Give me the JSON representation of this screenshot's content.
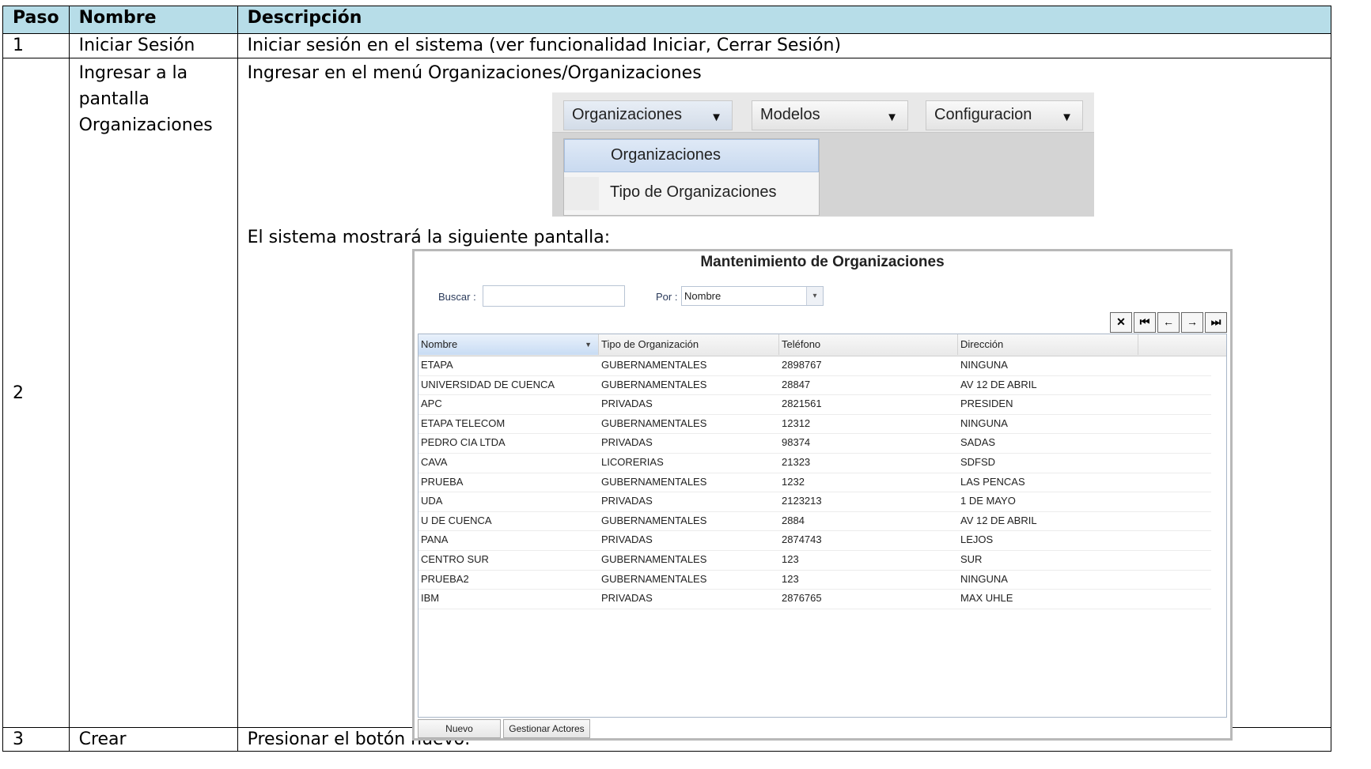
{
  "table": {
    "headers": {
      "paso": "Paso",
      "nombre": "Nombre",
      "descripcion": "Descripción"
    },
    "rows": [
      {
        "paso": "1",
        "nombre": "Iniciar Sesión",
        "descripcion": "Iniciar sesión en el sistema (ver funcionalidad Iniciar, Cerrar Sesión)"
      },
      {
        "paso": "2",
        "nombre_lines": [
          "Ingresar a la",
          "pantalla",
          "Organizaciones"
        ],
        "descripcion_1": "Ingresar en el menú Organizaciones/Organizaciones",
        "descripcion_2": "El sistema mostrará la siguiente pantalla:"
      },
      {
        "paso": "3",
        "nombre": "Crear",
        "descripcion": "Presionar el botón nuevo:"
      }
    ]
  },
  "menu": {
    "items": [
      "Organizaciones",
      "Modelos",
      "Configuracion"
    ],
    "dropdown": [
      "Organizaciones",
      "Tipo de Organizaciones"
    ],
    "dropdown_hover": "Organizaciones"
  },
  "app": {
    "title": "Mantenimiento de Organizaciones",
    "buscar_label": "Buscar :",
    "buscar_value": "",
    "por_label": "Por :",
    "por_value": "Nombre",
    "nav_buttons": [
      "✕",
      "⏮",
      "←",
      "→",
      "⏭"
    ],
    "columns": [
      "Nombre",
      "Tipo de Organización",
      "Teléfono",
      "Dirección"
    ],
    "sorted_column": "Nombre",
    "rows": [
      [
        "ETAPA",
        "GUBERNAMENTALES",
        "2898767",
        "NINGUNA"
      ],
      [
        "UNIVERSIDAD DE CUENCA",
        "GUBERNAMENTALES",
        "28847",
        "AV 12 DE ABRIL"
      ],
      [
        "APC",
        "PRIVADAS",
        "2821561",
        "PRESIDEN"
      ],
      [
        "ETAPA TELECOM",
        "GUBERNAMENTALES",
        "12312",
        "NINGUNA"
      ],
      [
        "PEDRO CIA LTDA",
        "PRIVADAS",
        "98374",
        "SADAS"
      ],
      [
        "CAVA",
        "LICORERIAS",
        "21323",
        "SDFSD"
      ],
      [
        "PRUEBA",
        "GUBERNAMENTALES",
        "1232",
        "LAS PENCAS"
      ],
      [
        "UDA",
        "PRIVADAS",
        "2123213",
        "1 DE MAYO"
      ],
      [
        "U DE CUENCA",
        "GUBERNAMENTALES",
        "2884",
        "AV 12 DE ABRIL"
      ],
      [
        "PANA",
        "PRIVADAS",
        "2874743",
        "LEJOS"
      ],
      [
        "CENTRO SUR",
        "GUBERNAMENTALES",
        "123",
        "SUR"
      ],
      [
        "PRUEBA2",
        "GUBERNAMENTALES",
        "123",
        "NINGUNA"
      ],
      [
        "IBM",
        "PRIVADAS",
        "2876765",
        "MAX UHLE"
      ]
    ],
    "footer_buttons": [
      "Nuevo",
      "Gestionar Actores"
    ]
  },
  "colors": {
    "header_bg": "#b7dde8",
    "menu_hover": "#c9daf0",
    "grid_sorted": "#c8dcf4"
  }
}
